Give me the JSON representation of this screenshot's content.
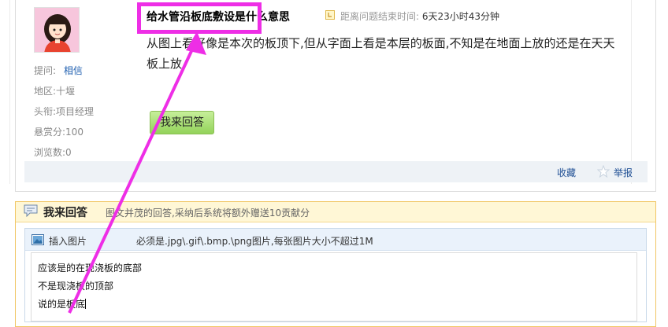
{
  "question": {
    "title": "给水管沿板底敷设是什么意思",
    "deadline_label": "距离问题结束时间:",
    "deadline_value": "6天23小时43分钟",
    "body": "从图上看好像是本次的板顶下,但从字面上看是本层的板面,不知是在地面上放的还是在天天板上放",
    "answer_button": "我来回答",
    "meta": {
      "asker_label": "提问:",
      "asker_value": "相信",
      "region_label": "地区:",
      "region_value": "十堰",
      "title_label": "头衔:",
      "title_value": "项目经理",
      "bounty_label": "悬赏分:",
      "bounty_value": "100",
      "views_label": "浏览数:",
      "views_value": "0"
    },
    "actions": {
      "collect": "收藏",
      "report": "举报"
    }
  },
  "answer_panel": {
    "title": "我来回答",
    "tip": "图文并茂的回答,采纳后系统将额外赠送10贡献分",
    "insert_image": "插入图片",
    "image_hint": "必须是.jpg\\.gif\\.bmp.\\png图片,每张图片大小不超过1M",
    "lines": [
      "应该是的在现浇板的底部",
      "不是现浇板的顶部",
      "说的是板底"
    ]
  },
  "icons": {
    "clock": "clock-icon",
    "star": "star-icon",
    "chat": "speech-bubble-icon",
    "image": "image-icon"
  },
  "colors": {
    "highlight": "#ee2ee6",
    "link": "#1f4f94",
    "answer_border": "#f1c664"
  }
}
